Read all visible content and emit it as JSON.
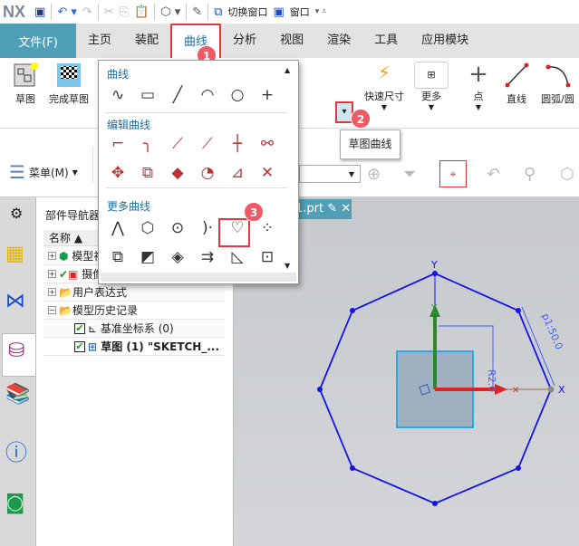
{
  "app": {
    "logo": "NX",
    "switch_window": "切换窗口",
    "window": "窗口"
  },
  "menubar": {
    "file": "文件(F)",
    "tabs": [
      "主页",
      "装配",
      "曲线",
      "分析",
      "视图",
      "渲染",
      "工具",
      "应用模块"
    ],
    "active": "曲线"
  },
  "ribbon": {
    "sketch": "草图",
    "finish_sketch": "完成草图",
    "quick_dim": "快速尺寸",
    "more": "更多",
    "point": "点",
    "line": "直线",
    "arc": "圆弧/圆"
  },
  "toolbar2": {
    "menu": "菜单(M)"
  },
  "tooltip": "草图曲线",
  "dropdown": {
    "sections": [
      "曲线",
      "编辑曲线",
      "更多曲线"
    ]
  },
  "badges": [
    "1",
    "2",
    "3"
  ],
  "navigator": {
    "title": "部件导航器",
    "column": "名称",
    "rows": [
      "模型视图",
      "摄像机",
      "用户表达式",
      "模型历史记录",
      "基准坐标系 (0)",
      "草图 (1) \"SKETCH_..."
    ]
  },
  "viewport": {
    "tab": "1.prt",
    "dim_p": "p1:50.0",
    "dim_r": "R2.0",
    "axis_x": "X",
    "axis_y": "Y"
  },
  "colors": {
    "accent": "#4fa0b7",
    "highlight": "#e2373c",
    "sketch": "#1414e6"
  }
}
